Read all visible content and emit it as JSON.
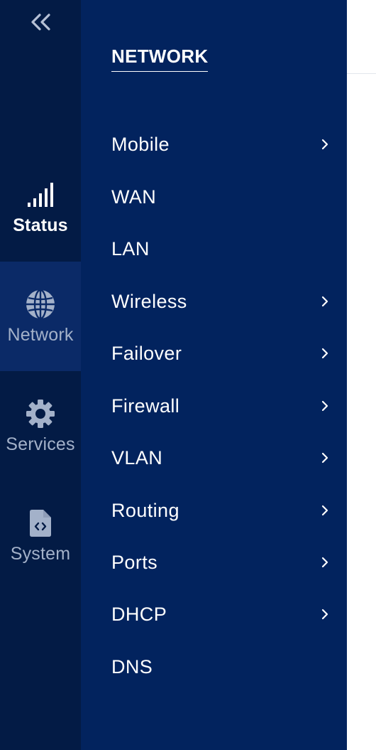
{
  "rail": {
    "collapse_icon": "double-chevron-left-icon",
    "items": [
      {
        "id": "status",
        "label": "Status",
        "icon": "signal-bars-icon"
      },
      {
        "id": "network",
        "label": "Network",
        "icon": "globe-icon"
      },
      {
        "id": "services",
        "label": "Services",
        "icon": "gear-icon"
      },
      {
        "id": "system",
        "label": "System",
        "icon": "code-file-icon"
      }
    ],
    "active": "Network"
  },
  "panel": {
    "title": "NETWORK",
    "items": [
      {
        "label": "Mobile",
        "has_submenu": true
      },
      {
        "label": "WAN",
        "has_submenu": false
      },
      {
        "label": "LAN",
        "has_submenu": false
      },
      {
        "label": "Wireless",
        "has_submenu": true
      },
      {
        "label": "Failover",
        "has_submenu": true
      },
      {
        "label": "Firewall",
        "has_submenu": true
      },
      {
        "label": "VLAN",
        "has_submenu": true
      },
      {
        "label": "Routing",
        "has_submenu": true
      },
      {
        "label": "Ports",
        "has_submenu": true
      },
      {
        "label": "DHCP",
        "has_submenu": true
      },
      {
        "label": "DNS",
        "has_submenu": false
      }
    ]
  },
  "colors": {
    "rail_bg": "#031b45",
    "rail_active_bg": "#0b2a67",
    "panel_bg": "#02235e",
    "text_primary": "#ffffff",
    "text_muted": "#a3b1c9"
  }
}
